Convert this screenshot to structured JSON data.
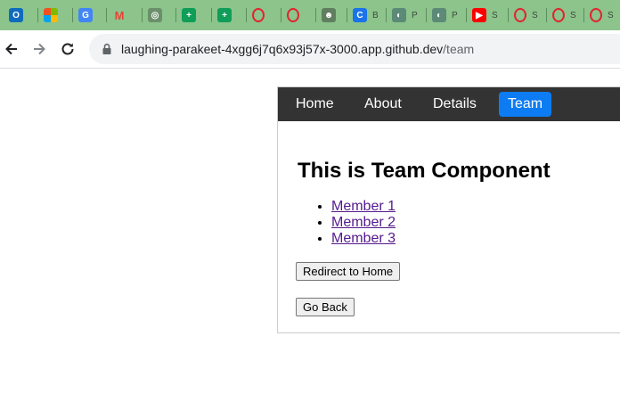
{
  "browser": {
    "tabs": [
      {
        "icon": "outlook-icon",
        "color": "#0f6cbd",
        "glyph": "O",
        "label": ""
      },
      {
        "icon": "microsoft-icon",
        "color": "#f25022",
        "glyph": "",
        "label": ""
      },
      {
        "icon": "google-translate-icon",
        "color": "#4285f4",
        "glyph": "G",
        "label": ""
      },
      {
        "icon": "gmail-icon",
        "color": "#ea4335",
        "glyph": "M",
        "label": ""
      },
      {
        "icon": "chatgpt-icon",
        "color": "#6b8f6b",
        "glyph": "◎",
        "label": ""
      },
      {
        "icon": "google-sheets-icon",
        "color": "#0f9d58",
        "glyph": "+",
        "label": ""
      },
      {
        "icon": "google-sheets-icon",
        "color": "#0f9d58",
        "glyph": "+",
        "label": ""
      },
      {
        "icon": "opera-icon",
        "color": "#e0242f",
        "glyph": "O",
        "label": ""
      },
      {
        "icon": "opera-icon",
        "color": "#e0242f",
        "glyph": "O",
        "label": ""
      },
      {
        "icon": "android-icon",
        "color": "#5f7f5f",
        "glyph": "☻",
        "label": ""
      },
      {
        "icon": "c-icon",
        "color": "#1a73e8",
        "glyph": "C",
        "label": "B"
      },
      {
        "icon": "p-icon",
        "color": "#5b8a76",
        "glyph": "◐",
        "label": "P"
      },
      {
        "icon": "p-icon",
        "color": "#5b8a76",
        "glyph": "◐",
        "label": "P"
      },
      {
        "icon": "youtube-icon",
        "color": "#ff0000",
        "glyph": "▶",
        "label": "S"
      },
      {
        "icon": "opera-icon",
        "color": "#e0242f",
        "glyph": "O",
        "label": "S"
      },
      {
        "icon": "opera-icon",
        "color": "#e0242f",
        "glyph": "O",
        "label": "S"
      },
      {
        "icon": "opera-icon",
        "color": "#e0242f",
        "glyph": "O",
        "label": "S"
      }
    ],
    "url_host": "laughing-parakeet-4xgg6j7q6x93j57x-3000.app.github.dev",
    "url_path": "/team"
  },
  "nav": {
    "home": "Home",
    "about": "About",
    "details": "Details",
    "team": "Team"
  },
  "page": {
    "heading": "This is Team Component",
    "members": [
      "Member 1",
      "Member 2",
      "Member 3"
    ],
    "redirect_button": "Redirect to Home",
    "back_button": "Go Back"
  },
  "colors": {
    "tabbar": "#8cc48c",
    "navbar": "#333333",
    "active_tab": "#0d7cf2",
    "link": "#551a8b"
  }
}
